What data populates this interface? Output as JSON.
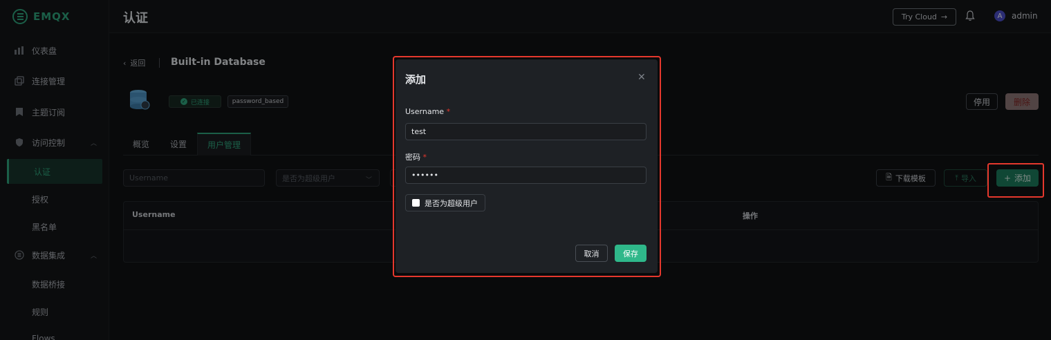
{
  "app": {
    "name": "EMQX"
  },
  "sidebar": {
    "items": [
      {
        "label": "仪表盘",
        "icon": "dashboard-icon"
      },
      {
        "label": "连接管理",
        "icon": "connections-icon"
      },
      {
        "label": "主题订阅",
        "icon": "topics-icon"
      },
      {
        "label": "访问控制",
        "icon": "shield-icon"
      },
      {
        "label": "数据集成",
        "icon": "integration-icon"
      }
    ],
    "access_sub": [
      "认证",
      "授权",
      "黑名单"
    ],
    "integration_sub": [
      "数据桥接",
      "规则",
      "Flows"
    ]
  },
  "header": {
    "title": "认证",
    "try_cloud": "Try Cloud",
    "avatar_letter": "A",
    "user": "admin"
  },
  "page": {
    "back": "返回",
    "title": "Built-in Database",
    "status": "已连接",
    "mechanism": "password_based",
    "disable_label": "停用",
    "delete_label": "删除",
    "tabs": [
      "概览",
      "设置",
      "用户管理"
    ],
    "active_tab": "用户管理",
    "filter_username_placeholder": "Username",
    "filter_superuser_placeholder": "是否为超级用户",
    "download_template": "下载模板",
    "import_label": "导入",
    "add_label": "添加",
    "table": {
      "columns": [
        "Username",
        "操作"
      ]
    }
  },
  "dialog": {
    "title": "添加",
    "username_label": "Username",
    "username_value": "test",
    "password_label": "密码",
    "password_value": "••••••",
    "superuser_label": "是否为超级用户",
    "superuser_checked": false,
    "cancel_label": "取消",
    "save_label": "保存"
  },
  "colors": {
    "accent": "#2fa47c",
    "highlight": "#e6382d",
    "danger": "#d8342f"
  }
}
